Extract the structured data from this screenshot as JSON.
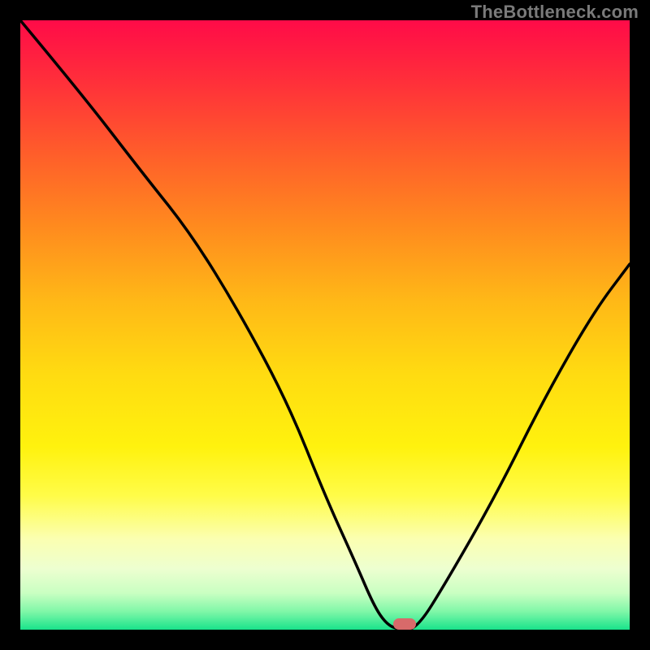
{
  "attribution": "TheBottleneck.com",
  "colors": {
    "page_bg": "#000000",
    "attribution_text": "#7a7a7a",
    "curve_stroke": "#000000",
    "marker_fill": "#d86a6a"
  },
  "chart_data": {
    "type": "line",
    "title": "",
    "xlabel": "",
    "ylabel": "",
    "xlim": [
      0,
      100
    ],
    "ylim": [
      0,
      100
    ],
    "grid": false,
    "legend": false,
    "series": [
      {
        "name": "bottleneck-curve",
        "x": [
          0,
          10,
          20,
          28,
          36,
          44,
          50,
          55,
          58,
          60,
          62,
          65,
          70,
          78,
          86,
          94,
          100
        ],
        "values": [
          100,
          88,
          75,
          65,
          52,
          37,
          22,
          11,
          4,
          1,
          0,
          0,
          8,
          22,
          38,
          52,
          60
        ]
      }
    ],
    "marker": {
      "x": 63,
      "y": 1
    },
    "gradient_stops": [
      {
        "pos": 0.0,
        "color": "#ff0b48"
      },
      {
        "pos": 0.1,
        "color": "#ff2f3a"
      },
      {
        "pos": 0.22,
        "color": "#ff5e2a"
      },
      {
        "pos": 0.34,
        "color": "#ff8b1e"
      },
      {
        "pos": 0.46,
        "color": "#ffb817"
      },
      {
        "pos": 0.58,
        "color": "#ffdb11"
      },
      {
        "pos": 0.7,
        "color": "#fff20e"
      },
      {
        "pos": 0.78,
        "color": "#fffc48"
      },
      {
        "pos": 0.85,
        "color": "#fbffb0"
      },
      {
        "pos": 0.9,
        "color": "#edffd0"
      },
      {
        "pos": 0.94,
        "color": "#c9ffc2"
      },
      {
        "pos": 0.97,
        "color": "#80f7a8"
      },
      {
        "pos": 1.0,
        "color": "#19e38b"
      }
    ]
  }
}
